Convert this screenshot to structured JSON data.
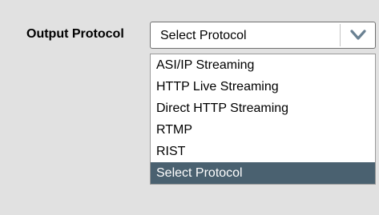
{
  "form": {
    "label": "Output Protocol",
    "select": {
      "value": "Select Protocol",
      "arrow_icon": "chevron-down-icon",
      "options": [
        "ASI/IP Streaming",
        "HTTP Live Streaming",
        "Direct HTTP Streaming",
        "RTMP",
        "RIST",
        "Select Protocol"
      ],
      "highlighted_option": "Select Protocol"
    }
  },
  "colors": {
    "background": "#e1e1e1",
    "highlight": "#4a6170",
    "arrow": "#6a8192"
  }
}
